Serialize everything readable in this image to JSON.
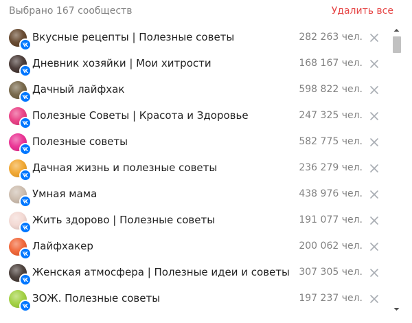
{
  "header": {
    "count_label": "Выбрано 167 сообществ",
    "delete_all_label": "Удалить все"
  },
  "communities": [
    {
      "name": "Вкусные рецепты | Полезные советы",
      "members": "282 263 чел.",
      "avatar_color": "#5a3a1e"
    },
    {
      "name": "Дневник хозяйки | Мои хитрости",
      "members": "168 167 чел.",
      "avatar_color": "#3a2a26"
    },
    {
      "name": "Дачный лайфхак",
      "members": "598 822 чел.",
      "avatar_color": "#6b5a3a"
    },
    {
      "name": "Полезные Советы | Красота и Здоровье",
      "members": "247 325 чел.",
      "avatar_color": "#e8317c"
    },
    {
      "name": "Полезные советы",
      "members": "582 775 чел.",
      "avatar_color": "#e8208a"
    },
    {
      "name": "Дачная жизнь и полезные советы",
      "members": "236 279 чел.",
      "avatar_color": "#f0a020"
    },
    {
      "name": "Умная мама",
      "members": "438 976 чел.",
      "avatar_color": "#c9b8a8"
    },
    {
      "name": "Жить здорово | Полезные советы",
      "members": "191 077 чел.",
      "avatar_color": "#f2d6d0"
    },
    {
      "name": "Лайфхакер",
      "members": "200 062 чел.",
      "avatar_color": "#f05a28"
    },
    {
      "name": "Женская атмосфера | Полезные идеи и советы",
      "members": "307 305 чел.",
      "avatar_color": "#3b2f2a"
    },
    {
      "name": "ЗОЖ. Полезные советы",
      "members": "197 237 чел.",
      "avatar_color": "#9acd32"
    }
  ],
  "colors": {
    "accent_red": "#e64646",
    "vk_blue": "#0077ff",
    "secondary_text": "#828282"
  },
  "icons": {
    "remove": "close-icon",
    "badge": "vk-logo-icon",
    "scroll_up": "chevron-up-icon",
    "scroll_down": "chevron-down-icon"
  }
}
